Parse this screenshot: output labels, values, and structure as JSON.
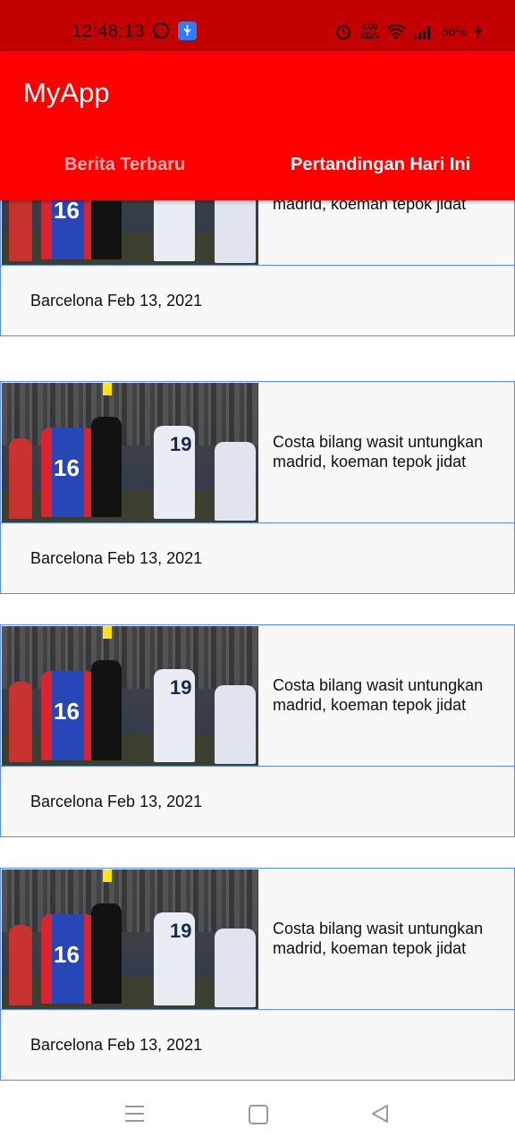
{
  "status_bar": {
    "time": "12:48:13",
    "net_speed_value": "0.00",
    "net_speed_unit": "KB/S",
    "battery": "66%",
    "icons": [
      "whatsapp-icon",
      "usb-icon",
      "alarm-icon",
      "wifi-icon",
      "signal-icon",
      "charging-icon"
    ]
  },
  "app_bar": {
    "title": "MyApp",
    "tabs": [
      {
        "label": "Berita Terbaru",
        "selected": false
      },
      {
        "label": "Pertandingan Hari Ini",
        "selected": true
      }
    ]
  },
  "news": [
    {
      "title": "Costa bilang wasit untungkan madrid, koeman tepok jidat",
      "meta": "Barcelona Feb 13, 2021"
    },
    {
      "title": "Costa bilang wasit untungkan madrid, koeman tepok jidat",
      "meta": "Barcelona Feb 13, 2021"
    },
    {
      "title": "Costa bilang wasit untungkan madrid, koeman tepok jidat",
      "meta": "Barcelona Feb 13, 2021"
    },
    {
      "title": "Costa bilang wasit untungkan madrid, koeman tepok jidat",
      "meta": "Barcelona Feb 13, 2021"
    }
  ],
  "thumbnail": {
    "jersey_left": "16",
    "jersey_right": "19"
  },
  "colors": {
    "status_bar": "#c20000",
    "app_bar": "#ff0000",
    "card_border": "#5a8be6"
  }
}
